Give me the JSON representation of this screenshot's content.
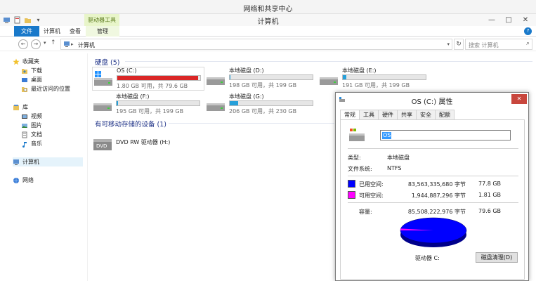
{
  "back_window": {
    "title": "网络和共享中心"
  },
  "window": {
    "title": "计算机",
    "tool_tab_label": "驱动器工具",
    "controls": {
      "minimize": "—",
      "maximize": "□",
      "close": "✕"
    }
  },
  "ribbon": {
    "tabs": [
      "文件",
      "计算机",
      "查看",
      "管理"
    ],
    "help": "?"
  },
  "address": {
    "path": "计算机",
    "search_placeholder": "搜索 计算机"
  },
  "nav": {
    "favorites": "收藏夹",
    "favorites_items": [
      "下载",
      "桌面",
      "最近访问的位置"
    ],
    "libraries": "库",
    "library_items": [
      "视频",
      "图片",
      "文档",
      "音乐"
    ],
    "computer": "计算机",
    "network": "网络"
  },
  "content": {
    "hard_drives_group": "硬盘 (5)",
    "removable_group": "有可移动存储的设备 (1)",
    "drives": [
      {
        "name": "OS (C:)",
        "free": "1.80 GB 可用，共 79.6 GB",
        "used_fraction": 0.977,
        "bar_color": "#da2626"
      },
      {
        "name": "本地磁盘 (D:)",
        "free": "198 GB 可用，共 199 GB",
        "used_fraction": 0.005,
        "bar_color": "#26a0da"
      },
      {
        "name": "本地磁盘 (E:)",
        "free": "191 GB 可用，共 199 GB",
        "used_fraction": 0.04,
        "bar_color": "#26a0da"
      },
      {
        "name": "本地磁盘 (F:)",
        "free": "195 GB 可用，共 199 GB",
        "used_fraction": 0.02,
        "bar_color": "#26a0da"
      },
      {
        "name": "本地磁盘 (G:)",
        "free": "206 GB 可用，共 230 GB",
        "used_fraction": 0.104,
        "bar_color": "#26a0da"
      }
    ],
    "dvd": {
      "name": "DVD RW 驱动器 (H:)",
      "icon_text": "DVD"
    }
  },
  "dialog": {
    "title": "OS (C:) 属性",
    "close": "✕",
    "tabs": [
      "常规",
      "工具",
      "硬件",
      "共享",
      "安全",
      "配额"
    ],
    "name_value": "OS",
    "type_label": "类型:",
    "type_value": "本地磁盘",
    "fs_label": "文件系统:",
    "fs_value": "NTFS",
    "used_label": "已用空间:",
    "used_bytes": "83,563,335,680 字节",
    "used_gb": "77.8 GB",
    "free_label": "可用空间:",
    "free_bytes": "1,944,887,296 字节",
    "free_gb": "1.81 GB",
    "capacity_label": "容量:",
    "capacity_bytes": "85,508,222,976 字节",
    "capacity_gb": "79.6 GB",
    "drive_label": "驱动器 C:",
    "cleanup_button": "磁盘清理(D)",
    "used_fraction": 0.977,
    "used_color": "#0000ff",
    "free_color": "#ff00ff"
  }
}
